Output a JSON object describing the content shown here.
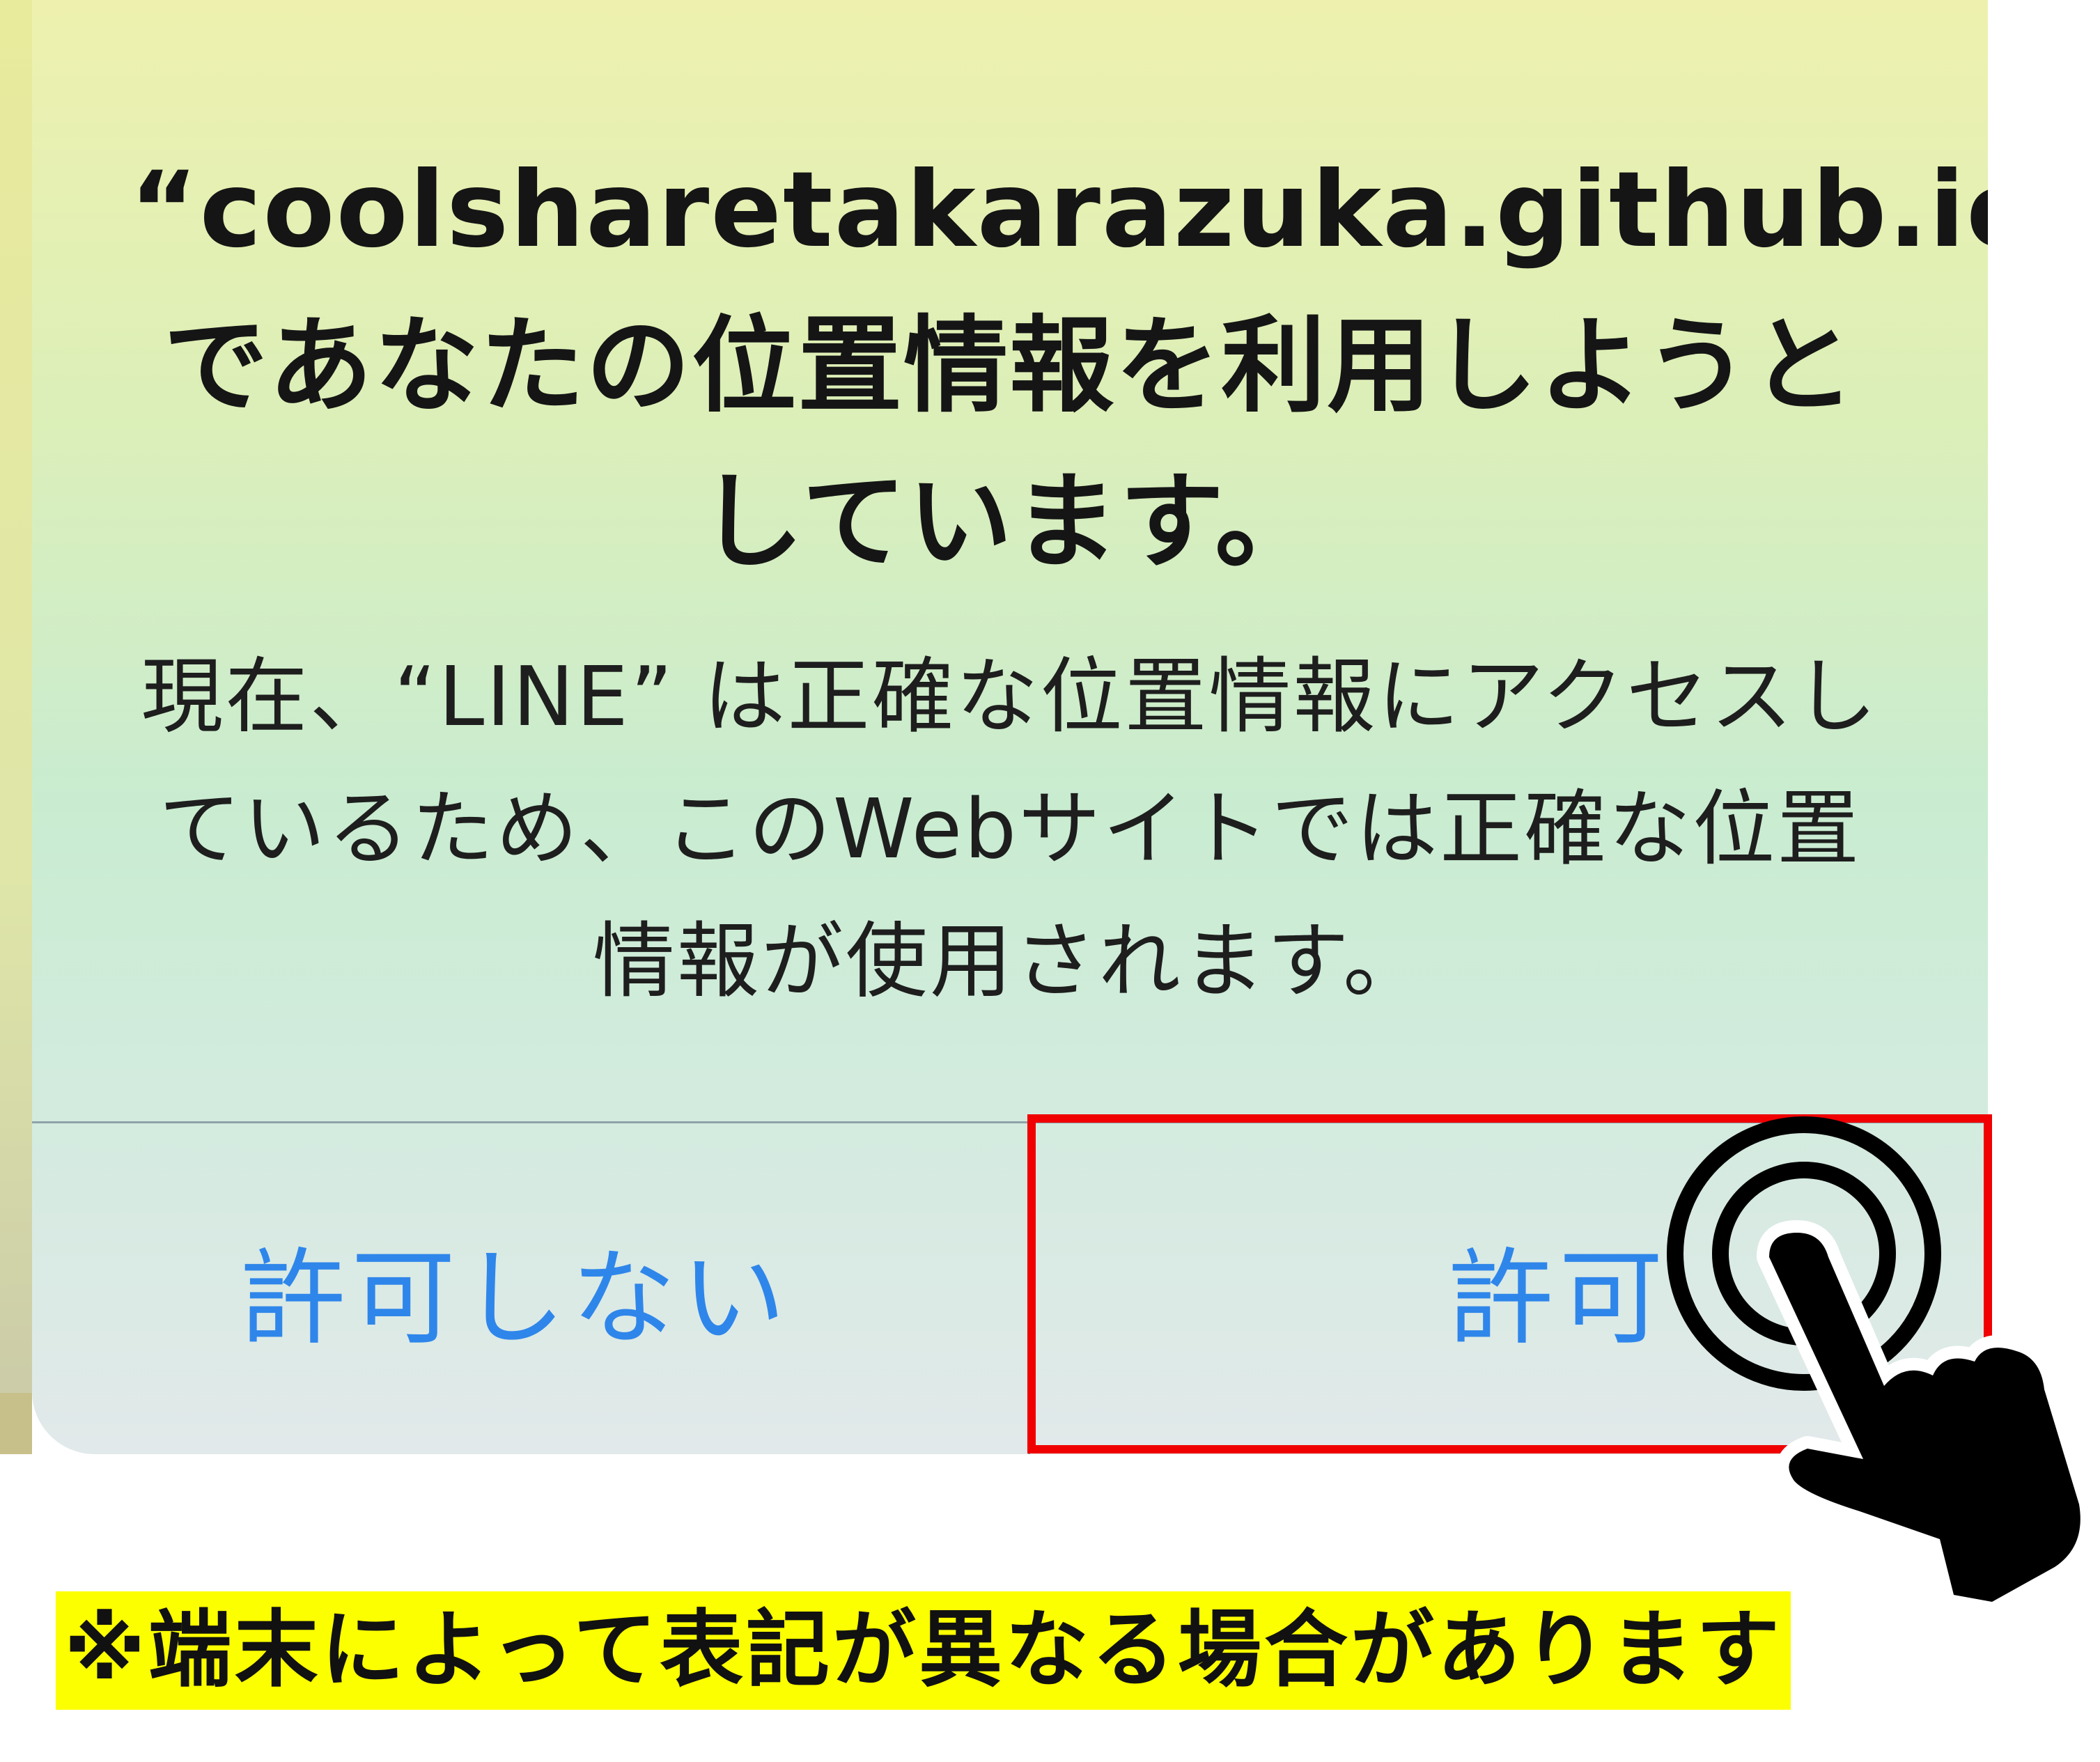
{
  "alert": {
    "title": "“coolsharetakarazuka.github.io” であなたの位置情報を利用しようとしています。",
    "message": "現在、“LINE” は正確な位置情報にアクセスしているため、このWebサイトでは正確な位置情報が使用されます。",
    "deny_label": "許可しない",
    "allow_label": "許可"
  },
  "note": {
    "text": "※端末によって表記が異なる場合があります"
  },
  "icons": {
    "tap": "pointing-hand-tap-icon"
  },
  "colors": {
    "button_text": "#2f86ea",
    "highlight_border": "#f00000",
    "note_background": "#fbff00",
    "title_text": "#151515"
  }
}
